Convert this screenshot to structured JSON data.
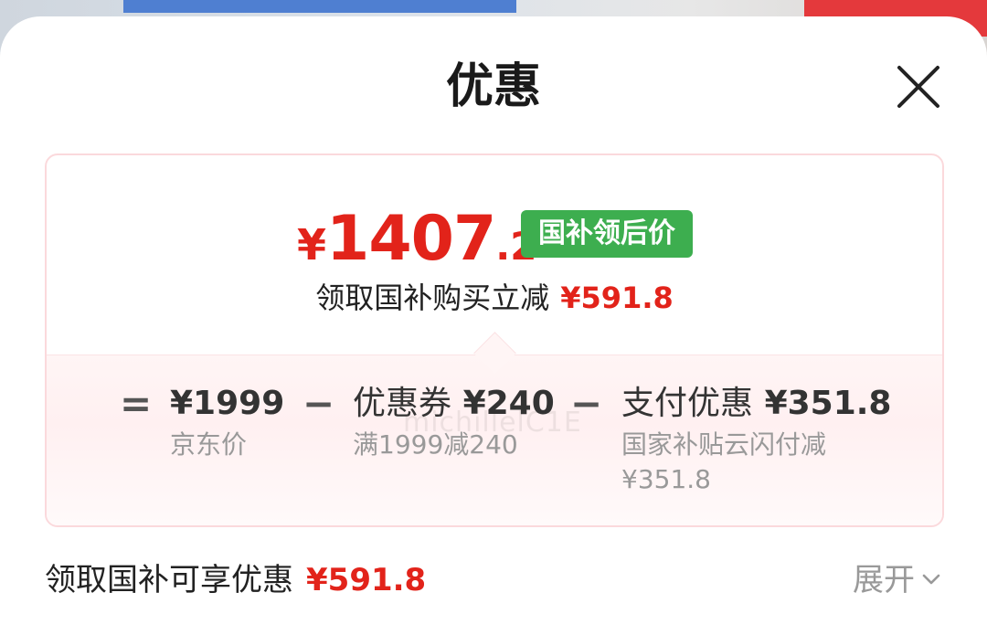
{
  "sheet": {
    "title": "优惠",
    "close_icon": "close-icon"
  },
  "summary": {
    "price_yen": "¥",
    "price_int": "1407",
    "price_dec": ".2",
    "badge": "国补领后价",
    "subline_text": "领取国补购买立减",
    "subline_amount": "¥591.8"
  },
  "breakdown": {
    "op_equals": "=",
    "op_minus_1": "−",
    "op_minus_2": "−",
    "items": [
      {
        "label": "",
        "amount": "¥1999",
        "note": "京东价"
      },
      {
        "label": "优惠券",
        "amount": "¥240",
        "note": "满1999减240"
      },
      {
        "label": "支付优惠",
        "amount": "¥351.8",
        "note": "国家补贴云闪付减",
        "note2": "¥351.8"
      }
    ]
  },
  "watermark": "michillelC1E",
  "footer": {
    "text": "领取国补可享优惠",
    "amount": "¥591.8",
    "expand_label": "展开",
    "expand_icon": "chevron-down-icon"
  },
  "colors": {
    "accent_red": "#e2231a",
    "badge_green": "#3dae4f",
    "card_border": "#fbd9dc"
  }
}
